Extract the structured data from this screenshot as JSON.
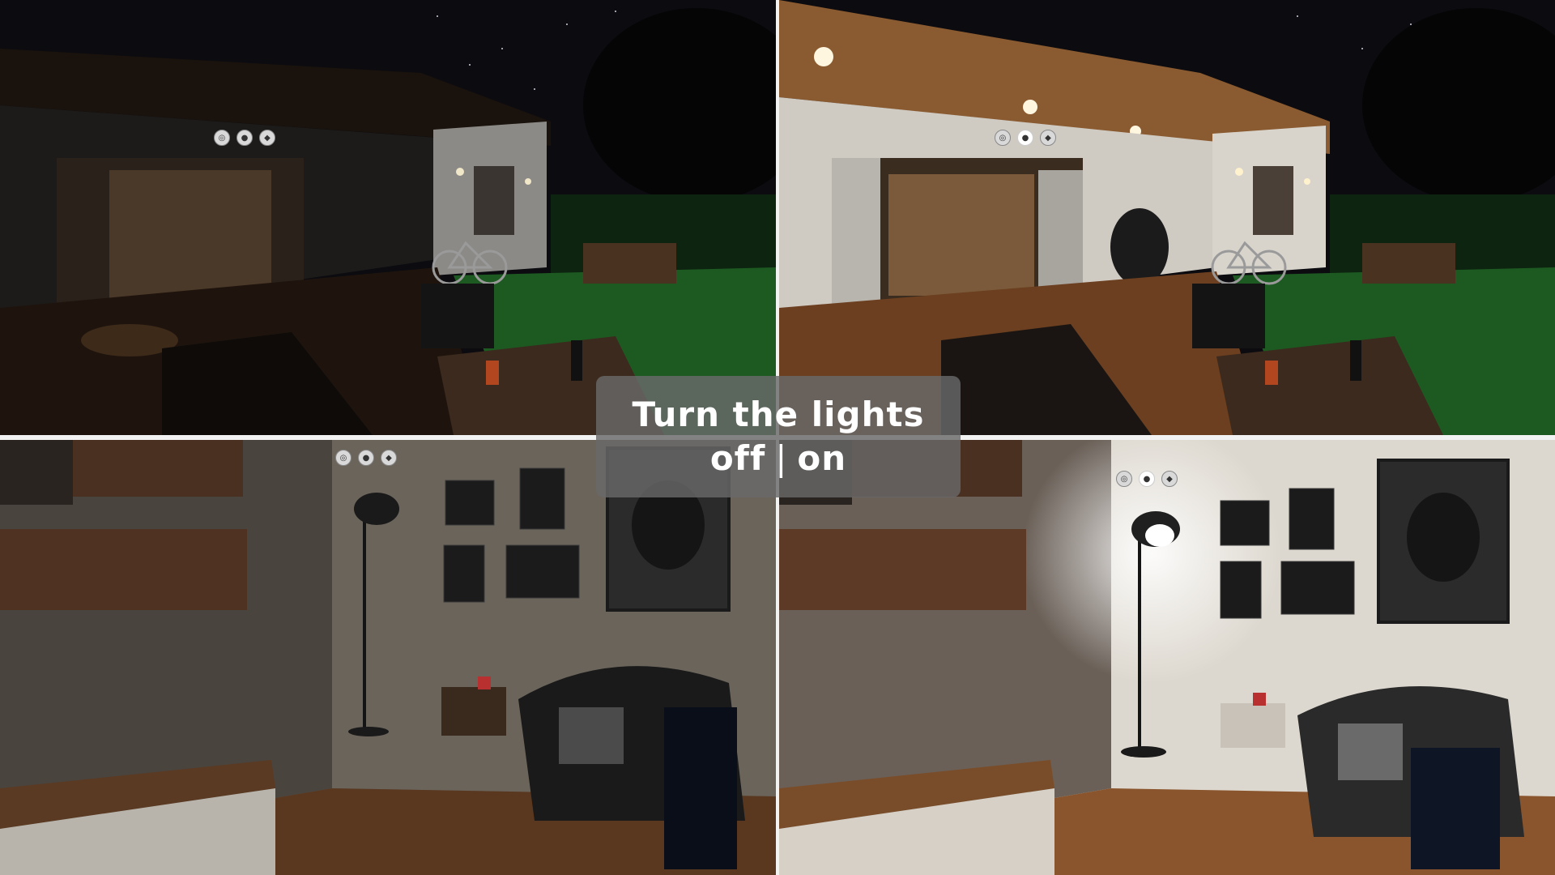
{
  "caption": {
    "title": "Turn the lights",
    "state_off": "off",
    "separator": "|",
    "state_on": "on"
  },
  "panels": [
    {
      "id": "exterior-lights-off",
      "scene": "patio",
      "lights": "off"
    },
    {
      "id": "exterior-lights-on",
      "scene": "patio",
      "lights": "on"
    },
    {
      "id": "interior-lights-off",
      "scene": "living-room",
      "lights": "off"
    },
    {
      "id": "interior-lights-on",
      "scene": "living-room",
      "lights": "on"
    }
  ],
  "light_controls": {
    "buttons": [
      {
        "icon": "settings-icon",
        "glyph": "◎"
      },
      {
        "icon": "bulb-icon",
        "glyph": "●"
      },
      {
        "icon": "pointer-icon",
        "glyph": "◆"
      }
    ]
  },
  "colors": {
    "caption_bg": "#696969",
    "night_sky": "#0a0a0f",
    "wood_floor": "#6b3f1f",
    "grass": "#1f5e22",
    "wall_warm": "#d9d4cc"
  }
}
